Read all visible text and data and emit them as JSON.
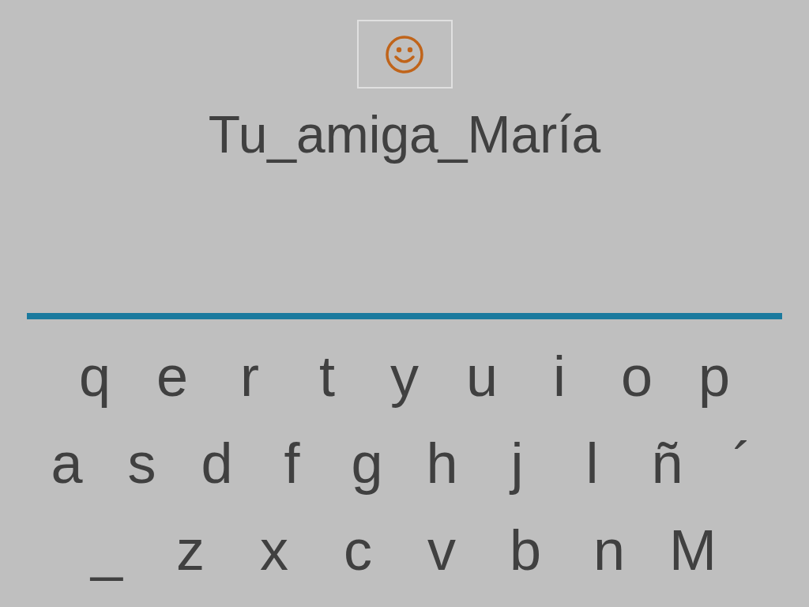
{
  "title": "Tu_amiga_María",
  "keyboard": {
    "rows": [
      [
        "q",
        "e",
        "r",
        "t",
        "y",
        "u",
        "i",
        "o",
        "p"
      ],
      [
        "a",
        "s",
        "d",
        "f",
        "g",
        "h",
        "j",
        "l",
        "ñ",
        "´"
      ],
      [
        "_",
        "z",
        "x",
        "c",
        "v",
        "b",
        "n",
        "M"
      ]
    ]
  }
}
